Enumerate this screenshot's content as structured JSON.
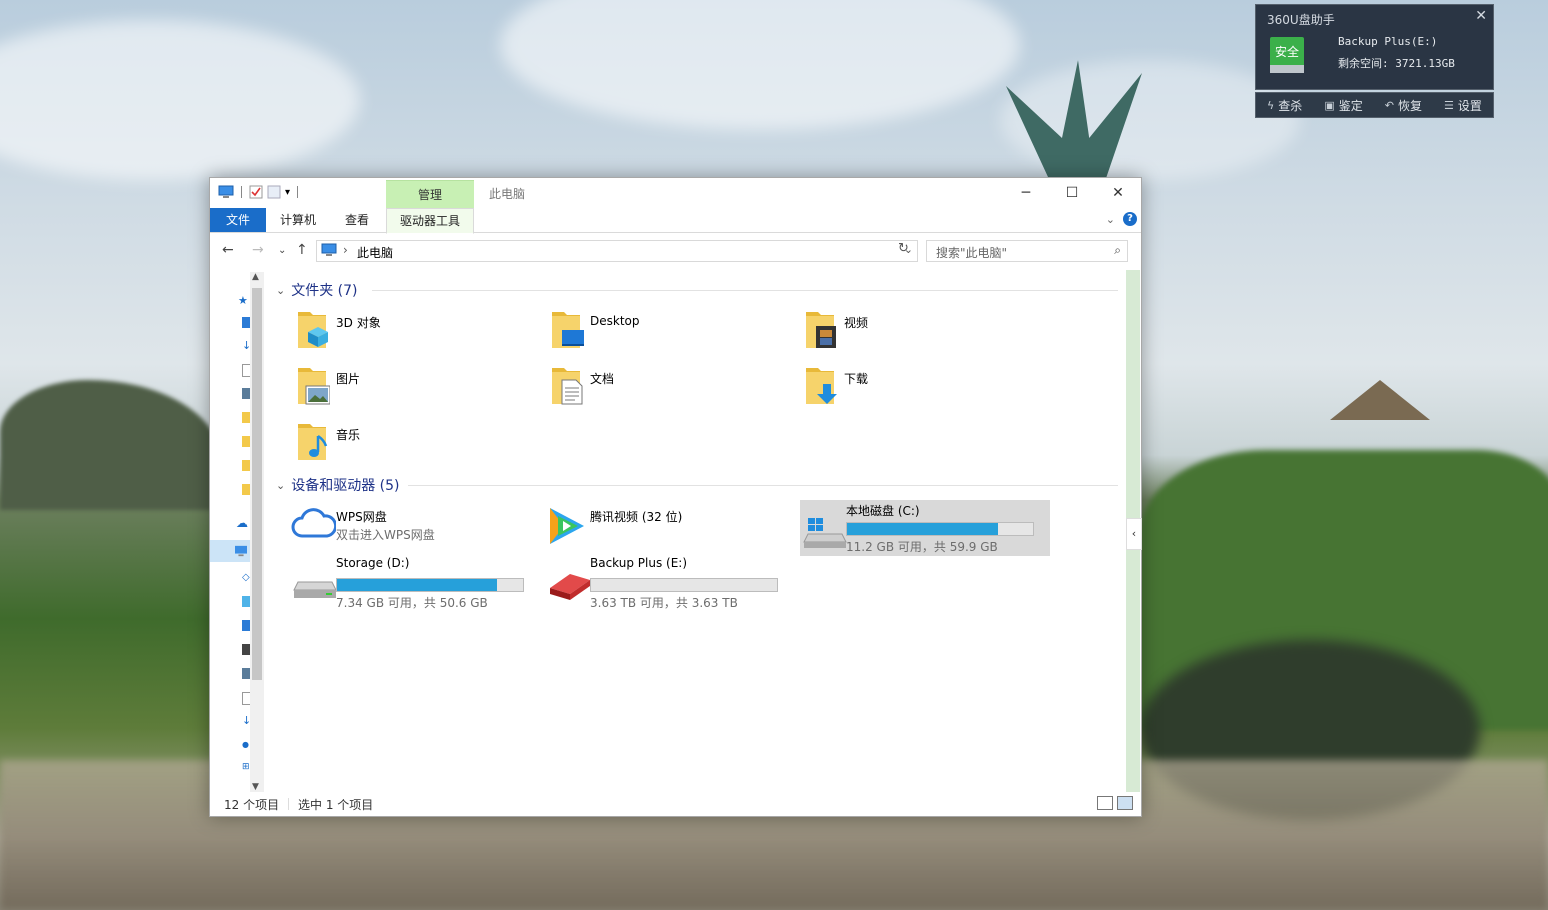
{
  "popup": {
    "title": "360U盘助手",
    "badge": "安全",
    "line1": "Backup Plus(E:)",
    "line2": "剩余空间: 3721.13GB",
    "actions": [
      {
        "label": "查杀",
        "icon": "lightning-icon"
      },
      {
        "label": "鉴定",
        "icon": "disk-icon"
      },
      {
        "label": "恢复",
        "icon": "restore-icon"
      },
      {
        "label": "设置",
        "icon": "settings-icon"
      }
    ]
  },
  "window": {
    "tool_tab": "管理",
    "title": "此电脑",
    "ribbon_tabs": [
      "文件",
      "计算机",
      "查看",
      "驱动器工具"
    ],
    "address": {
      "crumb": "此电脑",
      "search_placeholder": "搜索\"此电脑\""
    },
    "folders_header": "文件夹 (7)",
    "folders": [
      {
        "label": "3D 对象",
        "icon": "3d-objects-folder-icon"
      },
      {
        "label": "Desktop",
        "icon": "desktop-folder-icon"
      },
      {
        "label": "视频",
        "icon": "videos-folder-icon"
      },
      {
        "label": "图片",
        "icon": "pictures-folder-icon"
      },
      {
        "label": "文档",
        "icon": "documents-folder-icon"
      },
      {
        "label": "下载",
        "icon": "downloads-folder-icon"
      },
      {
        "label": "音乐",
        "icon": "music-folder-icon"
      }
    ],
    "devices_header": "设备和驱动器 (5)",
    "devices": [
      {
        "label": "WPS网盘",
        "sub": "双击进入WPS网盘",
        "icon": "cloud-icon"
      },
      {
        "label": "腾讯视频 (32 位)",
        "sub": "",
        "icon": "tencent-video-icon"
      },
      {
        "label": "本地磁盘 (C:)",
        "sub": "11.2 GB 可用，共 59.9 GB",
        "icon": "windows-drive-icon",
        "used_fraction": 0.81,
        "selected": true
      },
      {
        "label": "Storage (D:)",
        "sub": "7.34 GB 可用，共 50.6 GB",
        "icon": "hard-drive-icon",
        "used_fraction": 0.86
      },
      {
        "label": "Backup Plus (E:)",
        "sub": "3.63 TB 可用，共 3.63 TB",
        "icon": "external-drive-icon",
        "used_fraction": 0.0
      }
    ],
    "status": {
      "items": "12 个项目",
      "selected": "选中 1 个项目"
    }
  }
}
